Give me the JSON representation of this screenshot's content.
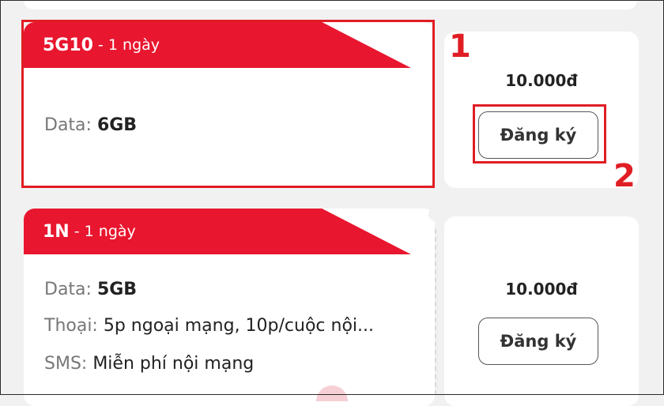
{
  "packages": [
    {
      "code": "5G10",
      "duration": " - 1 ngày",
      "data_label": "Data: ",
      "data_value": "6GB",
      "price": "10.000đ",
      "button_label": "Đăng ký"
    },
    {
      "code": "1N",
      "duration": " - 1 ngày",
      "data_label": "Data: ",
      "data_value": "5GB",
      "voice_label": "Thoại: ",
      "voice_value": "5p ngoại mạng, 10p/cuộc nội...",
      "sms_label": "SMS: ",
      "sms_value": "Miễn phí nội mạng",
      "price": "10.000đ",
      "button_label": "Đăng ký"
    }
  ],
  "annotations": {
    "first": "1",
    "second": "2"
  },
  "colors": {
    "brand_red": "#e8162e",
    "annotation_red": "#e01d24"
  }
}
